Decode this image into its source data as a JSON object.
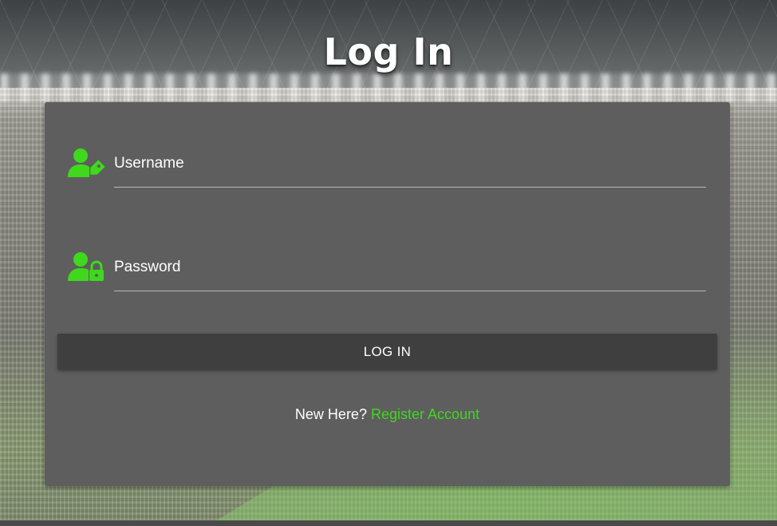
{
  "page": {
    "title": "Log In"
  },
  "form": {
    "username": {
      "placeholder": "Username",
      "value": "",
      "icon": "user-tag-icon"
    },
    "password": {
      "placeholder": "Password",
      "value": "",
      "icon": "user-lock-icon"
    },
    "submit_label": "LOG IN"
  },
  "footer": {
    "prompt": "New Here?",
    "register_link": "Register Account"
  },
  "colors": {
    "accent": "#3fd81d",
    "card": "#5e5e5e",
    "button": "#3f3f3f"
  }
}
